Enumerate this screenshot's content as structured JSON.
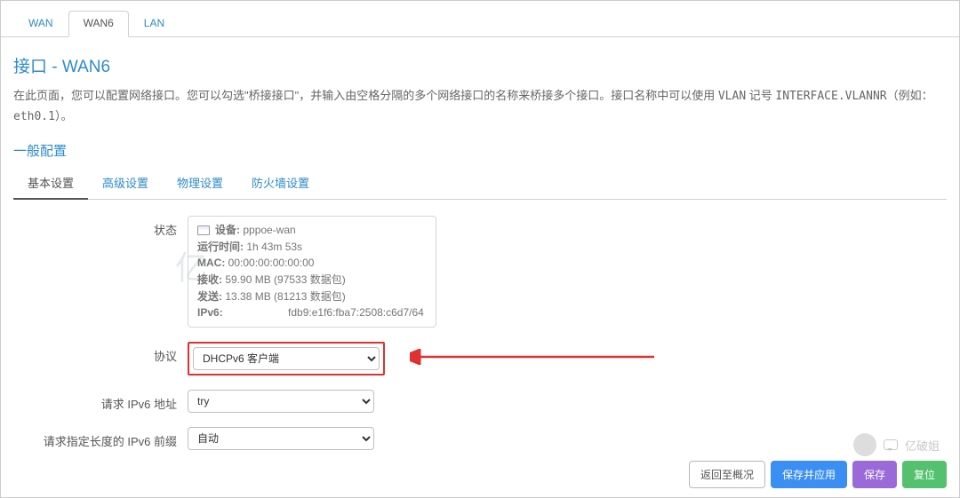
{
  "topTabs": {
    "wan": "WAN",
    "wan6": "WAN6",
    "lan": "LAN"
  },
  "heading": "接口 - WAN6",
  "descPrefix": "在此页面，您可以配置网络接口。您可以勾选\"桥接接口\"，并输入由空格分隔的多个网络接口的名称来桥接多个接口。接口名称中可以使用 ",
  "vlanWord": "VLAN",
  "descMid": " 记号 ",
  "ifaceToken": "INTERFACE.VLANNR",
  "descSuffixA": "（例如：",
  "ethToken": "eth0.1",
  "descSuffixB": "）。",
  "generalCfg": "一般配置",
  "subTabs": {
    "basic": "基本设置",
    "advanced": "高级设置",
    "physical": "物理设置",
    "firewall": "防火墙设置"
  },
  "labels": {
    "status": "状态",
    "protocol": "协议",
    "reqAddr": "请求 IPv6 地址",
    "reqPrefix": "请求指定长度的 IPv6 前缀"
  },
  "status": {
    "devLabel": "设备:",
    "devValue": "pppoe-wan",
    "uptimeLabel": "运行时间:",
    "uptimeValue": "1h 43m 53s",
    "macLabel": "MAC:",
    "macValue": "00:00:00:00:00:00",
    "rxLabel": "接收:",
    "rxValue": "59.90 MB (97533 数据包)",
    "txLabel": "发送:",
    "txValue": "13.38 MB (81213 数据包)",
    "ipv6Label": "IPv6:",
    "ipv6Value": "fdb9:e1f6:fba7:2508:c6d7/64"
  },
  "protocol": {
    "selected": "DHCPv6 客户端"
  },
  "reqAddr": {
    "selected": "try"
  },
  "reqPrefix": {
    "selected": "自动"
  },
  "buttons": {
    "back": "返回至概况",
    "saveApply": "保存并应用",
    "save": "保存",
    "reset": "复位"
  },
  "watermark": {
    "name": "亿破姐"
  },
  "ghost": "亿"
}
